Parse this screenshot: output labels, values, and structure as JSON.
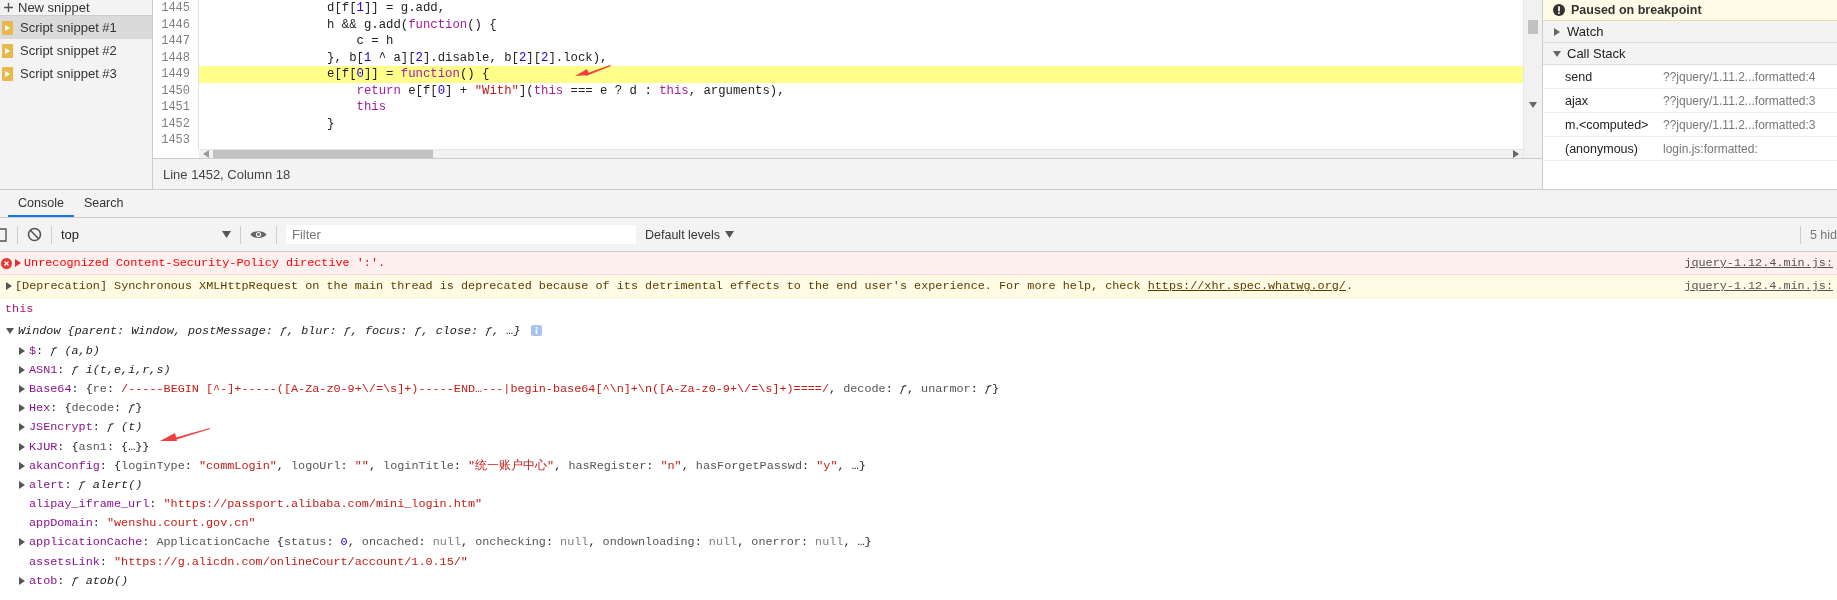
{
  "sidebar": {
    "new_snippet": "New snippet",
    "items": [
      {
        "label": "Script snippet #1",
        "selected": true
      },
      {
        "label": "Script snippet #2",
        "selected": false
      },
      {
        "label": "Script snippet #3",
        "selected": false
      }
    ]
  },
  "editor": {
    "lines": [
      {
        "number": "1445",
        "highlighted": false,
        "tokens": [
          {
            "kind": "plain",
            "text": "d[f["
          },
          {
            "kind": "number",
            "text": "1"
          },
          {
            "kind": "plain",
            "text": "]] = g.add,"
          }
        ]
      },
      {
        "number": "1446",
        "highlighted": false,
        "tokens": [
          {
            "kind": "plain",
            "text": "h && g.add("
          },
          {
            "kind": "keyword",
            "text": "function"
          },
          {
            "kind": "plain",
            "text": "() {"
          }
        ]
      },
      {
        "number": "1447",
        "highlighted": false,
        "tokens": [
          {
            "kind": "plain",
            "text": "    c = h"
          }
        ]
      },
      {
        "number": "1448",
        "highlighted": false,
        "tokens": [
          {
            "kind": "plain",
            "text": "}, b["
          },
          {
            "kind": "number",
            "text": "1"
          },
          {
            "kind": "plain",
            "text": " ^ a]["
          },
          {
            "kind": "number",
            "text": "2"
          },
          {
            "kind": "plain",
            "text": "].disable, b["
          },
          {
            "kind": "number",
            "text": "2"
          },
          {
            "kind": "plain",
            "text": "]["
          },
          {
            "kind": "number",
            "text": "2"
          },
          {
            "kind": "plain",
            "text": "].lock),"
          }
        ]
      },
      {
        "number": "1449",
        "highlighted": true,
        "tokens": [
          {
            "kind": "plain",
            "text": "e[f["
          },
          {
            "kind": "number",
            "text": "0"
          },
          {
            "kind": "plain",
            "text": "]] = "
          },
          {
            "kind": "keyword",
            "text": "function"
          },
          {
            "kind": "plain",
            "text": "() {"
          }
        ]
      },
      {
        "number": "1450",
        "highlighted": false,
        "tokens": [
          {
            "kind": "keyword",
            "text": "    return"
          },
          {
            "kind": "plain",
            "text": " e[f["
          },
          {
            "kind": "number",
            "text": "0"
          },
          {
            "kind": "plain",
            "text": "] + "
          },
          {
            "kind": "string",
            "text": "\"With\""
          },
          {
            "kind": "plain",
            "text": "]("
          },
          {
            "kind": "keyword",
            "text": "this"
          },
          {
            "kind": "plain",
            "text": " === e ? d : "
          },
          {
            "kind": "keyword",
            "text": "this"
          },
          {
            "kind": "plain",
            "text": ", arguments),"
          }
        ]
      },
      {
        "number": "1451",
        "highlighted": false,
        "tokens": [
          {
            "kind": "keyword",
            "text": "    this"
          }
        ]
      },
      {
        "number": "1452",
        "highlighted": false,
        "tokens": [
          {
            "kind": "plain",
            "text": "}"
          }
        ]
      },
      {
        "number": "1453",
        "highlighted": false
      }
    ],
    "status": "Line 1452, Column 18"
  },
  "debugger": {
    "banner": "Paused on breakpoint",
    "sections": [
      {
        "label": "Watch",
        "expanded": false
      },
      {
        "label": "Call Stack",
        "expanded": true,
        "frames": [
          {
            "function": "send",
            "location": "??jquery/1.11.2...formatted:4"
          },
          {
            "function": "ajax",
            "location": "??jquery/1.11.2...formatted:3"
          },
          {
            "function": "m.<computed>",
            "location": "??jquery/1.11.2...formatted:3"
          },
          {
            "function": "(anonymous)",
            "location": "login.js:formatted:"
          }
        ]
      }
    ]
  },
  "console": {
    "tabs": [
      {
        "label": "Console",
        "selected": true
      },
      {
        "label": "Search",
        "selected": false
      }
    ],
    "context": "top",
    "filter_placeholder": "Filter",
    "levels": "Default levels",
    "hidden_count": "5 hid",
    "messages": [
      {
        "kind": "error",
        "text": "Unrecognized Content-Security-Policy directive ':'.",
        "source": "jquery-1.12.4.min.js:"
      },
      {
        "kind": "warning",
        "text": "[Deprecation] Synchronous XMLHttpRequest on the main thread is deprecated because of its detrimental effects to the end user's experience. For more help, check ",
        "link": "https://xhr.spec.whatwg.org/",
        "text_after": ".",
        "source": "jquery-1.12.4.min.js:"
      }
    ],
    "result_label": "this",
    "object": {
      "label": "Window",
      "preview": "{parent: Window, postMessage: ƒ, blur: ƒ, focus: ƒ, close: ƒ, …}",
      "expanded": true,
      "properties": [
        {
          "key": "$",
          "expandable": true,
          "value": [
            {
              "kind": "plain",
              "text": ": "
            },
            {
              "kind": "function",
              "text": "ƒ (a,b)"
            }
          ]
        },
        {
          "key": "ASN1",
          "expandable": true,
          "value": [
            {
              "kind": "plain",
              "text": ": "
            },
            {
              "kind": "function",
              "text": "ƒ i(t,e,i,r,s)"
            }
          ]
        },
        {
          "key": "Base64",
          "expandable": true,
          "value": [
            {
              "kind": "plain",
              "text": ": {"
            },
            {
              "kind": "name",
              "text": "re"
            },
            {
              "kind": "plain",
              "text": ": "
            },
            {
              "kind": "string",
              "text": "/-----BEGIN [^-]+-----([A-Za-z0-9+\\/=\\s]+)-----END…---|begin-base64[^\\n]+\\n([A-Za-z0-9+\\/=\\s]+)====/"
            },
            {
              "kind": "plain",
              "text": ", "
            },
            {
              "kind": "name",
              "text": "decode"
            },
            {
              "kind": "plain",
              "text": ": "
            },
            {
              "kind": "function",
              "text": "ƒ"
            },
            {
              "kind": "plain",
              "text": ", "
            },
            {
              "kind": "name",
              "text": "unarmor"
            },
            {
              "kind": "plain",
              "text": ": "
            },
            {
              "kind": "function",
              "text": "ƒ"
            },
            {
              "kind": "plain",
              "text": "}"
            }
          ]
        },
        {
          "key": "Hex",
          "expandable": true,
          "value": [
            {
              "kind": "plain",
              "text": ": {"
            },
            {
              "kind": "name",
              "text": "decode"
            },
            {
              "kind": "plain",
              "text": ": "
            },
            {
              "kind": "function",
              "text": "ƒ"
            },
            {
              "kind": "plain",
              "text": "}"
            }
          ]
        },
        {
          "key": "JSEncrypt",
          "expandable": true,
          "value": [
            {
              "kind": "plain",
              "text": ": "
            },
            {
              "kind": "function",
              "text": "ƒ (t)"
            }
          ]
        },
        {
          "key": "KJUR",
          "expandable": true,
          "value": [
            {
              "kind": "plain",
              "text": ": {"
            },
            {
              "kind": "name",
              "text": "asn1"
            },
            {
              "kind": "plain",
              "text": ": {…}}"
            }
          ]
        },
        {
          "key": "akanConfig",
          "expandable": true,
          "value": [
            {
              "kind": "plain",
              "text": ": {"
            },
            {
              "kind": "name",
              "text": "loginType"
            },
            {
              "kind": "plain",
              "text": ": "
            },
            {
              "kind": "string",
              "text": "\"commLogin\""
            },
            {
              "kind": "plain",
              "text": ", "
            },
            {
              "kind": "name",
              "text": "logoUrl"
            },
            {
              "kind": "plain",
              "text": ": "
            },
            {
              "kind": "string",
              "text": "\"\""
            },
            {
              "kind": "plain",
              "text": ", "
            },
            {
              "kind": "name",
              "text": "loginTitle"
            },
            {
              "kind": "plain",
              "text": ": "
            },
            {
              "kind": "string",
              "text": "\"统一账户中心\""
            },
            {
              "kind": "plain",
              "text": ", "
            },
            {
              "kind": "name",
              "text": "hasRegister"
            },
            {
              "kind": "plain",
              "text": ": "
            },
            {
              "kind": "string",
              "text": "\"n\""
            },
            {
              "kind": "plain",
              "text": ", "
            },
            {
              "kind": "name",
              "text": "hasForgetPasswd"
            },
            {
              "kind": "plain",
              "text": ": "
            },
            {
              "kind": "string",
              "text": "\"y\""
            },
            {
              "kind": "plain",
              "text": ", …}"
            }
          ]
        },
        {
          "key": "alert",
          "expandable": true,
          "value": [
            {
              "kind": "plain",
              "text": ": "
            },
            {
              "kind": "function",
              "text": "ƒ alert()"
            }
          ]
        },
        {
          "key": "alipay_iframe_url",
          "expandable": false,
          "value": [
            {
              "kind": "plain",
              "text": ": "
            },
            {
              "kind": "string",
              "text": "\"https://passport.alibaba.com/mini_login.htm\""
            }
          ]
        },
        {
          "key": "appDomain",
          "expandable": false,
          "value": [
            {
              "kind": "plain",
              "text": ": "
            },
            {
              "kind": "string",
              "text": "\"wenshu.court.gov.cn\""
            }
          ]
        },
        {
          "key": "applicationCache",
          "expandable": true,
          "value": [
            {
              "kind": "plain",
              "text": ": "
            },
            {
              "kind": "class",
              "text": "ApplicationCache"
            },
            {
              "kind": "plain",
              "text": " {"
            },
            {
              "kind": "name",
              "text": "status"
            },
            {
              "kind": "plain",
              "text": ": "
            },
            {
              "kind": "number",
              "text": "0"
            },
            {
              "kind": "plain",
              "text": ", "
            },
            {
              "kind": "name",
              "text": "oncached"
            },
            {
              "kind": "plain",
              "text": ": "
            },
            {
              "kind": "null",
              "text": "null"
            },
            {
              "kind": "plain",
              "text": ", "
            },
            {
              "kind": "name",
              "text": "onchecking"
            },
            {
              "kind": "plain",
              "text": ": "
            },
            {
              "kind": "null",
              "text": "null"
            },
            {
              "kind": "plain",
              "text": ", "
            },
            {
              "kind": "name",
              "text": "ondownloading"
            },
            {
              "kind": "plain",
              "text": ": "
            },
            {
              "kind": "null",
              "text": "null"
            },
            {
              "kind": "plain",
              "text": ", "
            },
            {
              "kind": "name",
              "text": "onerror"
            },
            {
              "kind": "plain",
              "text": ": "
            },
            {
              "kind": "null",
              "text": "null"
            },
            {
              "kind": "plain",
              "text": ", …}"
            }
          ]
        },
        {
          "key": "assetsLink",
          "expandable": false,
          "value": [
            {
              "kind": "plain",
              "text": ": "
            },
            {
              "kind": "string",
              "text": "\"https://g.alicdn.com/onlineCourt/account/1.0.15/\""
            }
          ]
        },
        {
          "key": "atob",
          "expandable": true,
          "value": [
            {
              "kind": "plain",
              "text": ": "
            },
            {
              "kind": "function",
              "text": "ƒ atob()"
            }
          ]
        }
      ]
    }
  }
}
